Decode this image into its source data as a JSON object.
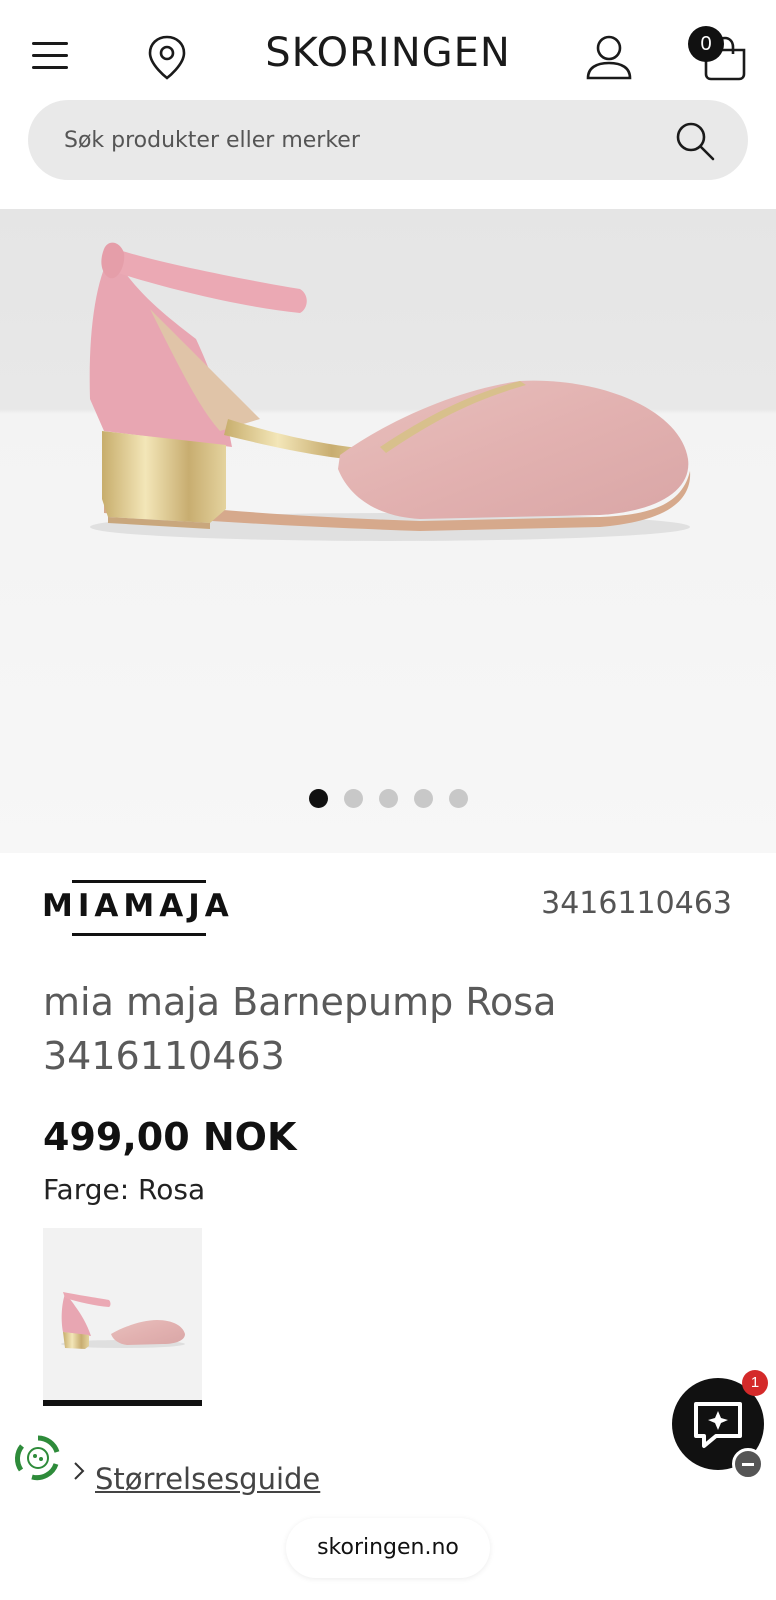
{
  "header": {
    "logo": "SKORINGEN",
    "cart_count": "0"
  },
  "search": {
    "placeholder": "Søk produkter eller merker"
  },
  "gallery": {
    "image_count": 5,
    "active_index": 0,
    "product_image": "pink-glitter-ankle-strap-pump"
  },
  "product": {
    "brand": "MIAMAJA",
    "article_number": "3416110463",
    "title": "mia maja Barnepump Rosa 3416110463",
    "price": "499,00 NOK",
    "color_label": "Farge: Rosa"
  },
  "links": {
    "size_guide": "Størrelsesguide"
  },
  "chat": {
    "badge": "1"
  },
  "browser": {
    "url": "skoringen.no"
  },
  "colors": {
    "shoe_pink": "#e8a6b2",
    "glitter_pink": "#e3b6b5",
    "heel_gold": "#d9c58a",
    "chat_bg": "#111111",
    "badge_red": "#d42a2a"
  }
}
